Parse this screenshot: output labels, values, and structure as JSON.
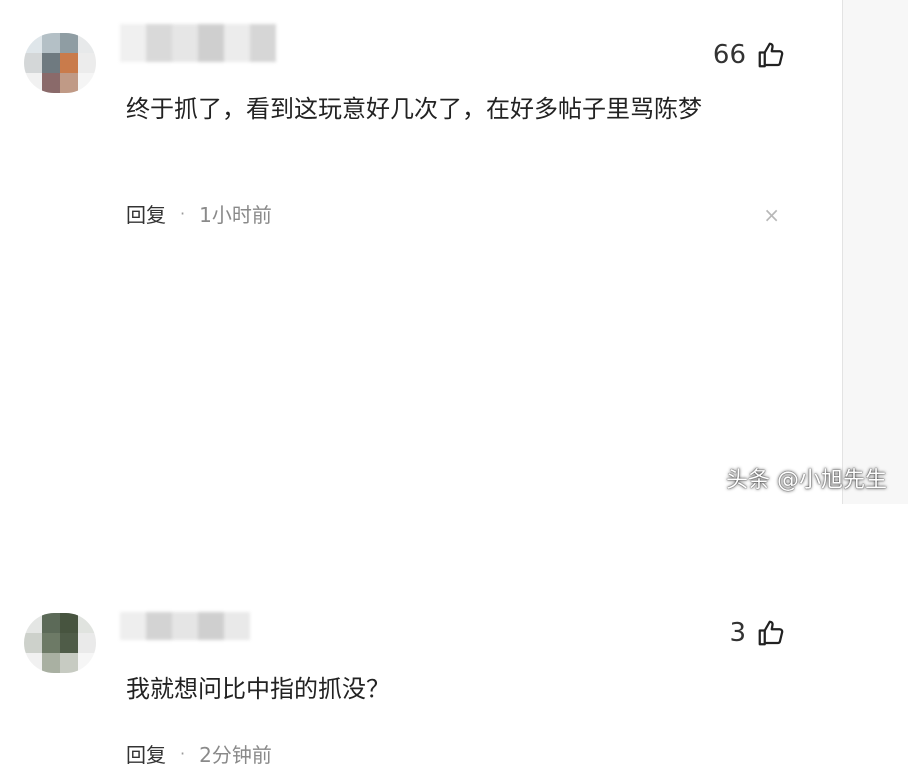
{
  "comments": [
    {
      "likes": "66",
      "text": "终于抓了，看到这玩意好几次了，在好多帖子里骂陈梦",
      "reply_label": "回复",
      "time": "1小时前",
      "dismiss": "×"
    },
    {
      "likes": "3",
      "text": "我就想问比中指的抓没？",
      "reply_label": "回复",
      "time": "2分钟前"
    }
  ],
  "separator": "·",
  "watermark": "头条 @小旭先生",
  "icons": {
    "like": "thumbs-up-icon",
    "dismiss": "close-icon"
  },
  "colors": {
    "text": "#222222",
    "meta": "#8a8a8a",
    "background": "#ffffff"
  }
}
